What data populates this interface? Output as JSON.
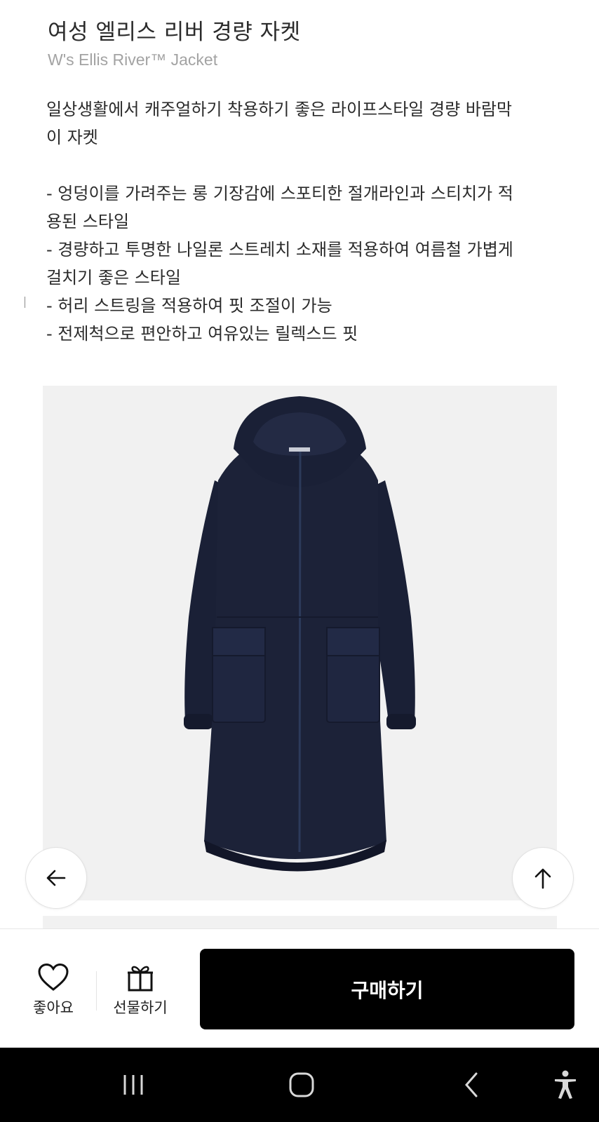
{
  "product": {
    "title": "여성 엘리스 리버 경량 자켓",
    "subtitle": "W's Ellis River™ Jacket",
    "description_lines": [
      "일상생활에서 캐주얼하기 착용하기 좋은 라이프스타일 경량 바람막",
      "이 자켓",
      "",
      "- 엉덩이를 가려주는 롱 기장감에 스포티한 절개라인과 스티치가 적",
      "용된 스타일",
      "- 경량하고 투명한 나일론 스트레치 소재를 적용하여 여름철 가볍게",
      "걸치기 좋은 스타일",
      "- 허리 스트링을 적용하여 핏 조절이 가능",
      "- 전제척으로 편안하고 여유있는 릴렉스드 핏"
    ]
  },
  "floating_buttons": {
    "back_icon": "arrow-left-icon",
    "top_icon": "arrow-up-icon"
  },
  "bottom_bar": {
    "like_label": "좋아요",
    "gift_label": "선물하기",
    "buy_label": "구매하기"
  },
  "colors": {
    "jacket": "#1c2238",
    "panel": "#f1f1f1",
    "buy_button": "#000000",
    "nav_bar": "#000000"
  },
  "system_nav": {
    "items": [
      "recent-apps-icon",
      "home-icon",
      "back-icon",
      "accessibility-icon"
    ]
  }
}
